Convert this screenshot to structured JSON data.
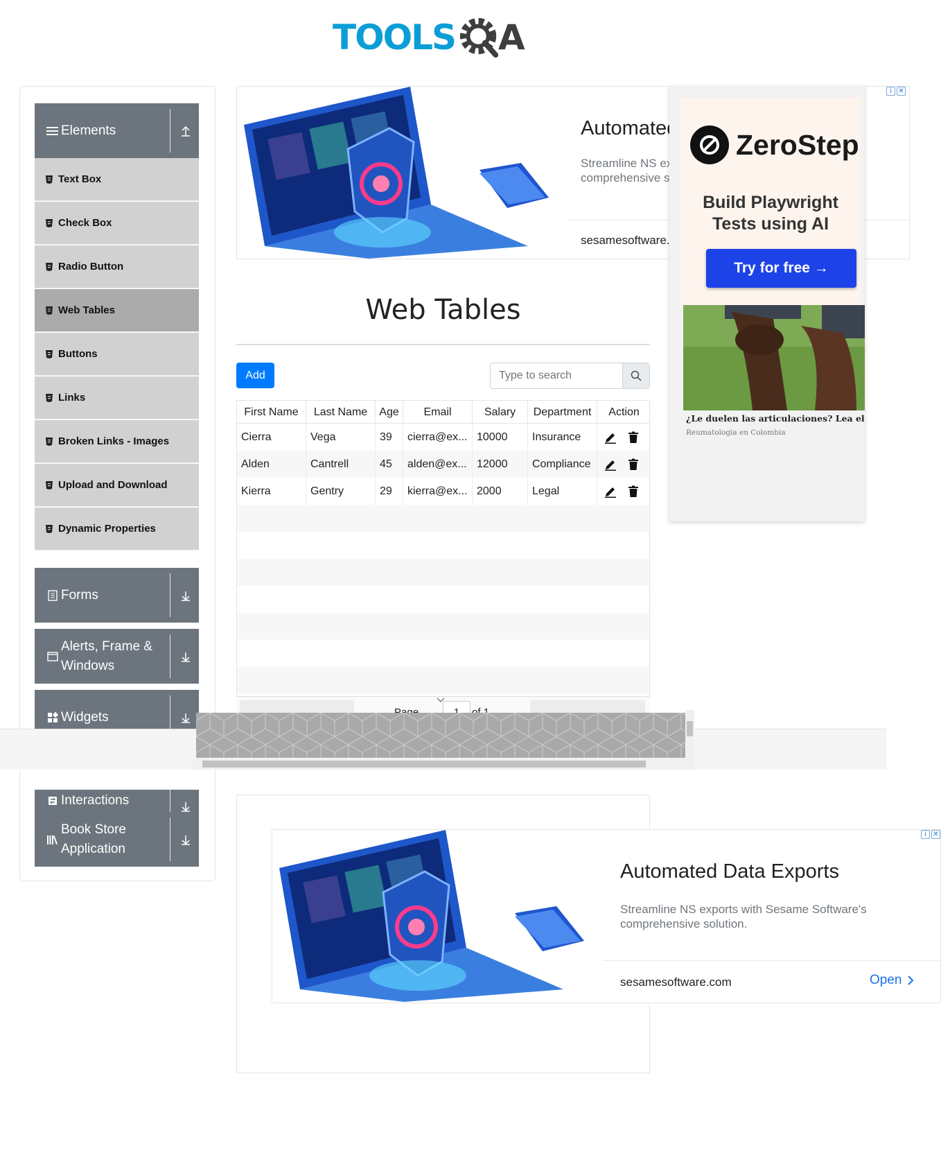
{
  "header": {
    "logo_part1": "TOOLS",
    "logo_part2": "A"
  },
  "sidebar": {
    "groups": [
      {
        "label": "Elements",
        "icon": "hamburger-icon",
        "state": "expanded"
      },
      {
        "label": "Forms",
        "icon": "document-icon",
        "state": "collapsed"
      },
      {
        "label": "Alerts, Frame & Windows",
        "icon": "window-icon",
        "state": "collapsed"
      },
      {
        "label": "Widgets",
        "icon": "widgets-icon",
        "state": "collapsed"
      },
      {
        "label": "Interactions",
        "icon": "interactions-icon",
        "state": "collapsed"
      },
      {
        "label": "Book Store Application",
        "icon": "books-icon",
        "state": "collapsed"
      }
    ],
    "items": [
      {
        "label": "Text Box"
      },
      {
        "label": "Check Box"
      },
      {
        "label": "Radio Button"
      },
      {
        "label": "Web Tables",
        "active": true
      },
      {
        "label": "Buttons"
      },
      {
        "label": "Links"
      },
      {
        "label": "Broken Links - Images"
      },
      {
        "label": "Upload and Download"
      },
      {
        "label": "Dynamic Properties"
      }
    ]
  },
  "ad_top": {
    "title": "Automated Data Exports",
    "desc": "Streamline NS exports with Sesame Software's comprehensive solution.",
    "url": "sesamesoftware.com"
  },
  "zerostep_ad": {
    "brand": "ZeroStep",
    "tagline": "Build Playwright Tests using AI",
    "cta": "Try for free →",
    "caption": "¿Le duelen las articulaciones? Lea el artículo",
    "source": "Reumatologia en Colombia"
  },
  "main": {
    "title": "Web Tables",
    "add_label": "Add",
    "search_placeholder": "Type to search"
  },
  "table": {
    "columns": [
      "First Name",
      "Last Name",
      "Age",
      "Email",
      "Salary",
      "Department",
      "Action"
    ],
    "rows": [
      [
        "Cierra",
        "Vega",
        "39",
        "cierra@ex...",
        "10000",
        "Insurance"
      ],
      [
        "Alden",
        "Cantrell",
        "45",
        "alden@ex...",
        "12000",
        "Compliance"
      ],
      [
        "Kierra",
        "Gentry",
        "29",
        "kierra@ex...",
        "2000",
        "Legal"
      ]
    ],
    "pager": {
      "page_label": "Page",
      "page_value": "1",
      "of_label": "of 1"
    }
  },
  "ad_bottom": {
    "title": "Automated Data Exports",
    "desc": "Streamline NS exports with Sesame Software's comprehensive solution.",
    "url": "sesamesoftware.com",
    "open_label": "Open"
  },
  "colors": {
    "brand_blue": "#0b9ed6",
    "sidebar_header": "#6c757d",
    "menu_item": "#d1d1d1",
    "menu_active": "#ababab",
    "primary": "#007bff",
    "cta_blue": "#1d43e8"
  }
}
